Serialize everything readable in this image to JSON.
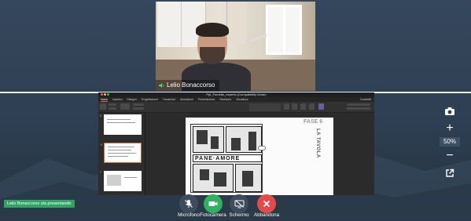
{
  "camera": {
    "participant_name": "Lelio Bonaccorso"
  },
  "shared_screen": {
    "app_title": "Ppt_Fumetto_esperto (Compatibility Mode)",
    "tabs": [
      "Home",
      "Inserisci",
      "Disegno",
      "Progettazione",
      "Transizioni",
      "Animazioni",
      "Presentazione",
      "Revisione",
      "Visualizza"
    ],
    "active_tab": "Home",
    "share_label": "Condividi",
    "slide": {
      "heading": "FASE 6",
      "subheading": "LA TAVOLA",
      "comic_sign": "PANE·AMORE"
    },
    "thumbnail_numbers": [
      "5",
      "6",
      "7"
    ]
  },
  "zoom": {
    "level": "50%"
  },
  "status": {
    "presenting_text": "Lelio Bonaccorso sta presentando"
  },
  "toolbar": {
    "mic_label": "Microfono",
    "camera_label": "Fotocamera",
    "screen_label": "Schermo",
    "leave_label": "Abbandona"
  },
  "colors": {
    "background": "#2d3e52",
    "accent_green": "#2eb25f",
    "leave_red": "#e54a4a",
    "presenting_green": "#2fa564"
  }
}
